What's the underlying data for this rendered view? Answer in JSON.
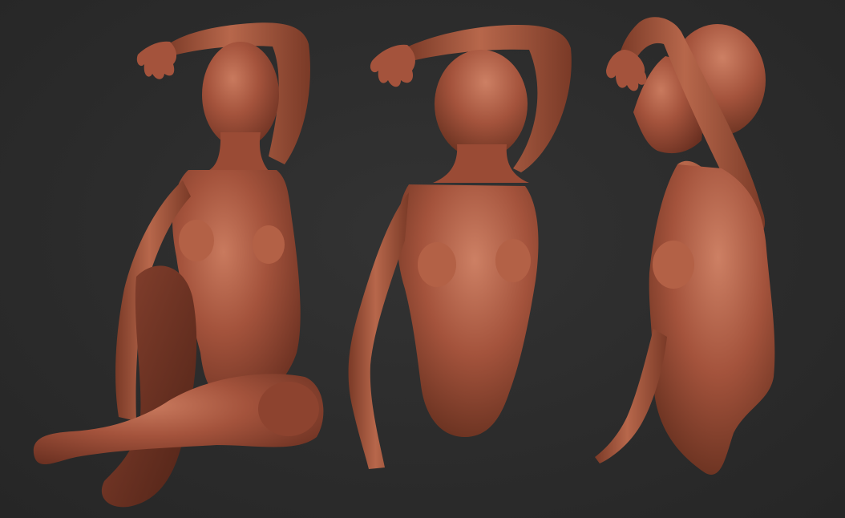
{
  "scene": {
    "background_color": "#2b2b2b",
    "material_color": "#a4533c",
    "material_highlight": "#c97a5e",
    "material_shadow": "#5e2a1c",
    "views": [
      {
        "name": "three-quarter-view-full-figure"
      },
      {
        "name": "front-view-torso"
      },
      {
        "name": "side-view-torso"
      }
    ]
  }
}
